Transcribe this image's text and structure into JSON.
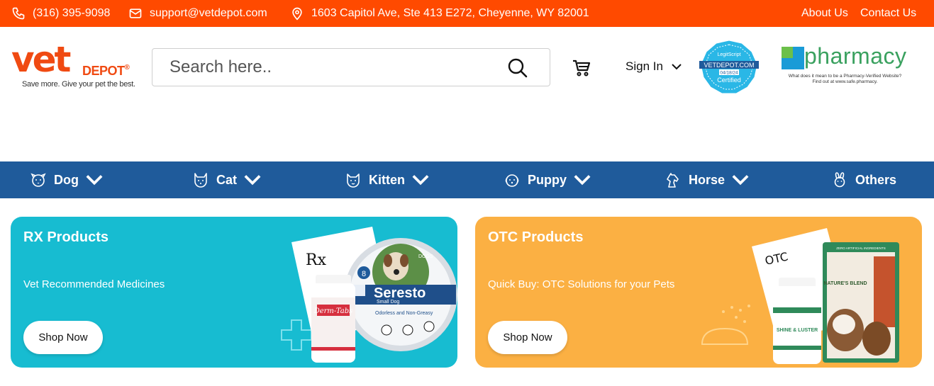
{
  "topbar": {
    "phone": "(316) 395-9098",
    "email": "support@vetdepot.com",
    "address": "1603 Capitol Ave, Ste 413 E272, Cheyenne, WY 82001",
    "about": "About Us",
    "contact": "Contact Us",
    "color": "#ff4a00"
  },
  "logo": {
    "vet": "vet",
    "depot": "DEPOT",
    "reg": "®",
    "tagline": "Save more. Give your pet the best."
  },
  "search": {
    "placeholder": "Search here.."
  },
  "header": {
    "signin": "Sign In"
  },
  "legitscript": {
    "brand": "LegitScript",
    "site": "VETDEPOT.COM",
    "date": "04/18/24",
    "status": "Certified"
  },
  "pharmacy": {
    "word": "pharmacy",
    "sub1": "What does it mean to be a Pharmacy-Verified Website?",
    "sub2": "Find out at www.safe.pharmacy."
  },
  "nav": {
    "color": "#1f5b9b",
    "items": [
      {
        "label": "Dog",
        "icon": "dog-face-icon"
      },
      {
        "label": "Cat",
        "icon": "cat-face-icon"
      },
      {
        "label": "Kitten",
        "icon": "kitten-face-icon"
      },
      {
        "label": "Puppy",
        "icon": "puppy-face-icon"
      },
      {
        "label": "Horse",
        "icon": "horse-head-icon"
      },
      {
        "label": "Others",
        "icon": "rabbit-icon"
      }
    ]
  },
  "cards": {
    "rx": {
      "title": "RX Products",
      "subtitle": "Vet Recommended Medicines",
      "button": "Shop Now",
      "color": "#17bcd1",
      "pad_label": "Rx",
      "bottle_label": "Derm-Tabs",
      "collar_brand": "Seresto",
      "collar_sub": "Small Dog",
      "collar_note": "Odorless and Non-Greasy",
      "collar_badge": "8",
      "collar_dogs": "DOGS"
    },
    "otc": {
      "title": "OTC Products",
      "subtitle": "Quick Buy: OTC Solutions for your Pets",
      "button": "Shop Now",
      "color": "#fbb043",
      "pad_label": "OTC",
      "bottle_label": "SHINE & LUSTER",
      "bag_label": "NATURE'S BLEND",
      "bag_top": "ZERO ARTIFICIAL INGREDIENTS"
    }
  }
}
